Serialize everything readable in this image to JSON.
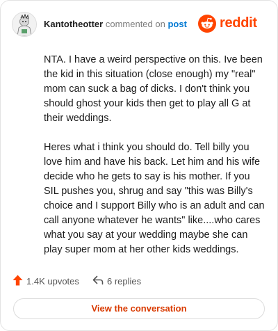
{
  "comment": {
    "username": "Kantotheotter",
    "action": "commented on",
    "post_link": "post",
    "paragraphs": [
      "NTA. I have a weird perspective on this. Ive been the kid in this situation (close enough) my \"real\" mom can suck a bag of dicks. I don't think you should ghost your kids then get to play all G at their weddings.",
      "Heres what i think you should do. Tell billy you love him and have his back. Let him and his wife decide who he gets to say is his mother. If you SIL pushes you, shrug and say \"this was Billy's choice and I support Billy who is an adult and can call anyone whatever he wants\" like....who cares what you say at your wedding maybe she can play super mom at her other kids weddings."
    ]
  },
  "brand": {
    "wordmark": "reddit",
    "color": "#ff4500"
  },
  "footer": {
    "upvotes": "1.4K upvotes",
    "replies": "6 replies",
    "view_button": "View the conversation"
  },
  "icons": {
    "upvote": "upvote-arrow-icon",
    "reply": "reply-arrow-icon",
    "logo": "reddit-snoo-icon",
    "avatar": "user-avatar"
  }
}
